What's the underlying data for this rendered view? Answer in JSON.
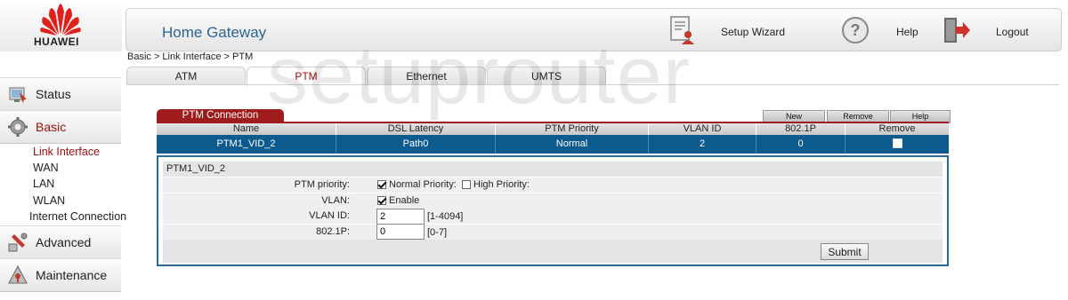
{
  "brand": {
    "name": "HUAWEI"
  },
  "header": {
    "title": "Home Gateway",
    "setup_wizard": "Setup Wizard",
    "help": "Help",
    "logout": "Logout"
  },
  "breadcrumb": "Basic > Link Interface > PTM",
  "tabs": [
    {
      "label": "ATM",
      "active": false
    },
    {
      "label": "PTM",
      "active": true
    },
    {
      "label": "Ethernet",
      "active": false
    },
    {
      "label": "UMTS",
      "active": false
    }
  ],
  "sidebar": {
    "status": "Status",
    "basic": "Basic",
    "basic_items": [
      "Link Interface",
      "WAN",
      "LAN",
      "WLAN",
      "Internet Connection"
    ],
    "advanced": "Advanced",
    "maintenance": "Maintenance"
  },
  "watermark": "setuprouter",
  "connection": {
    "tab_label": "PTM Connection",
    "buttons": {
      "new": "New",
      "remove": "Remove",
      "help": "Help"
    },
    "columns": [
      "Name",
      "DSL Latency",
      "PTM Priority",
      "VLAN ID",
      "802.1P",
      "Remove"
    ],
    "row": {
      "name": "PTM1_VID_2",
      "dsl_latency": "Path0",
      "ptm_priority": "Normal",
      "vlan_id": "2",
      "p8021": "0"
    }
  },
  "detail": {
    "title": "PTM1_VID_2",
    "ptm_priority_label": "PTM priority:",
    "normal_priority": "Normal Priority:",
    "high_priority": "High Priority:",
    "normal_checked": true,
    "high_checked": false,
    "vlan_label": "VLAN:",
    "vlan_enable": "Enable",
    "vlan_checked": true,
    "vlan_id_label": "VLAN ID:",
    "vlan_id_value": "2",
    "vlan_id_range": "[1-4094]",
    "p8021_label": "802.1P:",
    "p8021_value": "0",
    "p8021_range": "[0-7]",
    "submit": "Submit"
  },
  "colors": {
    "accent_red": "#a01c1c",
    "row_blue": "#0d5a8f",
    "title_blue": "#2a6496"
  }
}
